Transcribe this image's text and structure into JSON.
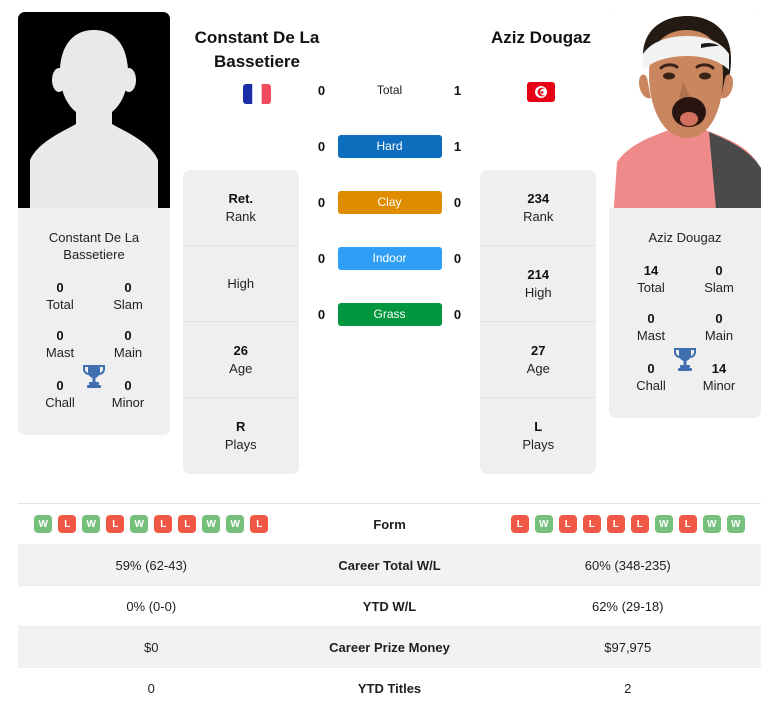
{
  "players": {
    "left": {
      "name": "Constant De La Bassetiere",
      "name_line1": "Constant De La",
      "name_line2": "Bassetiere",
      "card_name_line1": "Constant De La",
      "card_name_line2": "Bassetiere",
      "country_flag": "france-flag-icon",
      "photo": "player-silhouette-placeholder",
      "rank": "Ret.",
      "high": "",
      "age": "26",
      "plays": "R",
      "titles": {
        "total": "0",
        "slam": "0",
        "mast": "0",
        "main": "0",
        "chall": "0",
        "minor": "0"
      },
      "surface_wins": {
        "total": "0",
        "hard": "0",
        "clay": "0",
        "indoor": "0",
        "grass": "0"
      },
      "form": [
        "W",
        "L",
        "W",
        "L",
        "W",
        "L",
        "L",
        "W",
        "W",
        "L"
      ],
      "career_total_wl": "59% (62-43)",
      "ytd_wl": "0% (0-0)",
      "career_prize_money": "$0",
      "ytd_titles": "0"
    },
    "right": {
      "name": "Aziz Dougaz",
      "name_line1": "Aziz Dougaz",
      "card_name_line1": "Aziz Dougaz",
      "country_flag": "tunisia-flag-icon",
      "photo": "player-photo",
      "rank": "234",
      "high": "214",
      "age": "27",
      "plays": "L",
      "titles": {
        "total": "14",
        "slam": "0",
        "mast": "0",
        "main": "0",
        "chall": "0",
        "minor": "14"
      },
      "surface_wins": {
        "total": "1",
        "hard": "1",
        "clay": "0",
        "indoor": "0",
        "grass": "0"
      },
      "form": [
        "L",
        "W",
        "L",
        "L",
        "L",
        "L",
        "W",
        "L",
        "W",
        "W"
      ],
      "career_total_wl": "60% (348-235)",
      "ytd_wl": "62% (29-18)",
      "career_prize_money": "$97,975",
      "ytd_titles": "2"
    }
  },
  "labels": {
    "rank": "Rank",
    "high": "High",
    "age": "Age",
    "plays": "Plays",
    "titles_total": "Total",
    "titles_slam": "Slam",
    "titles_mast": "Mast",
    "titles_main": "Main",
    "titles_chall": "Chall",
    "titles_minor": "Minor",
    "trophy_icon": "trophy-icon"
  },
  "surfaces": [
    {
      "key": "total",
      "label": "Total",
      "color": "transparent",
      "text_color": "#1a1a1a"
    },
    {
      "key": "hard",
      "label": "Hard",
      "color": "#0d6ebd",
      "text_color": "#ffffff"
    },
    {
      "key": "clay",
      "label": "Clay",
      "color": "#e08c00",
      "text_color": "#ffffff"
    },
    {
      "key": "indoor",
      "label": "Indoor",
      "color": "#2f9ff5",
      "text_color": "#ffffff"
    },
    {
      "key": "grass",
      "label": "Grass",
      "color": "#00973e",
      "text_color": "#ffffff"
    }
  ],
  "stats_rows": [
    {
      "label": "Form",
      "type": "form"
    },
    {
      "label": "Career Total W/L",
      "type": "text",
      "key": "career_total_wl"
    },
    {
      "label": "YTD W/L",
      "type": "text",
      "key": "ytd_wl"
    },
    {
      "label": "Career Prize Money",
      "type": "text",
      "key": "career_prize_money"
    },
    {
      "label": "YTD Titles",
      "type": "text",
      "key": "ytd_titles"
    }
  ],
  "colors": {
    "win_badge": "#76c07b",
    "loss_badge": "#ef5844",
    "panel_bg": "#efefef",
    "row_alt_bg": "#f2f2f2",
    "trophy": "#3f6fb0",
    "hard": "#0d6ebd",
    "clay": "#e08c00",
    "indoor": "#2f9ff5",
    "grass": "#00973e"
  }
}
